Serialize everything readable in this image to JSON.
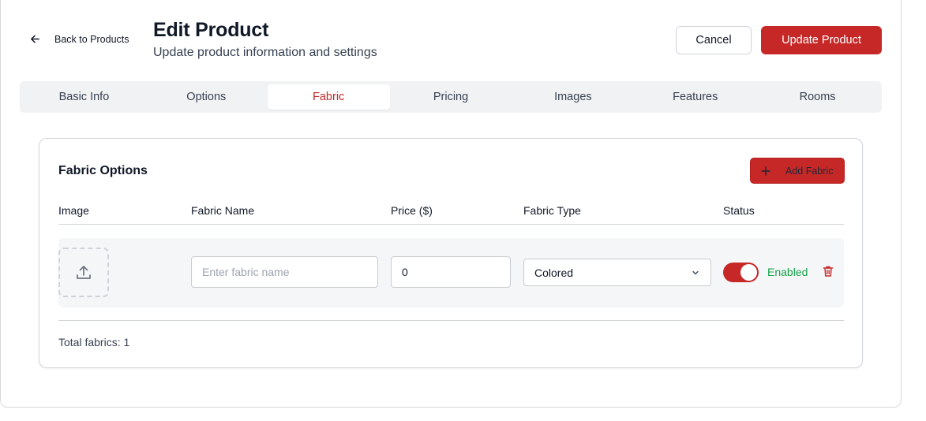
{
  "header": {
    "back_label": "Back to Products",
    "title": "Edit Product",
    "subtitle": "Update product information and settings",
    "cancel_label": "Cancel",
    "update_label": "Update Product"
  },
  "tabs": [
    {
      "label": "Basic Info",
      "active": false
    },
    {
      "label": "Options",
      "active": false
    },
    {
      "label": "Fabric",
      "active": true
    },
    {
      "label": "Pricing",
      "active": false
    },
    {
      "label": "Images",
      "active": false
    },
    {
      "label": "Features",
      "active": false
    },
    {
      "label": "Rooms",
      "active": false
    }
  ],
  "fabric": {
    "title": "Fabric Options",
    "add_label": "Add Fabric",
    "columns": [
      "Image",
      "Fabric Name",
      "Price ($)",
      "Fabric Type",
      "Status"
    ],
    "rows": [
      {
        "name_value": "",
        "name_placeholder": "Enter fabric name",
        "price_value": "0",
        "type_value": "Colored",
        "status_enabled": true,
        "status_label": "Enabled"
      }
    ],
    "total_text": "Total fabrics: 1"
  },
  "colors": {
    "accent": "#c62828",
    "success": "#16a34a",
    "tab_bar": "#f1f2f4"
  },
  "icons": {
    "back": "arrow-left-icon",
    "add": "plus-icon",
    "upload": "upload-icon",
    "select": "chevron-down-icon",
    "delete": "trash-icon"
  }
}
